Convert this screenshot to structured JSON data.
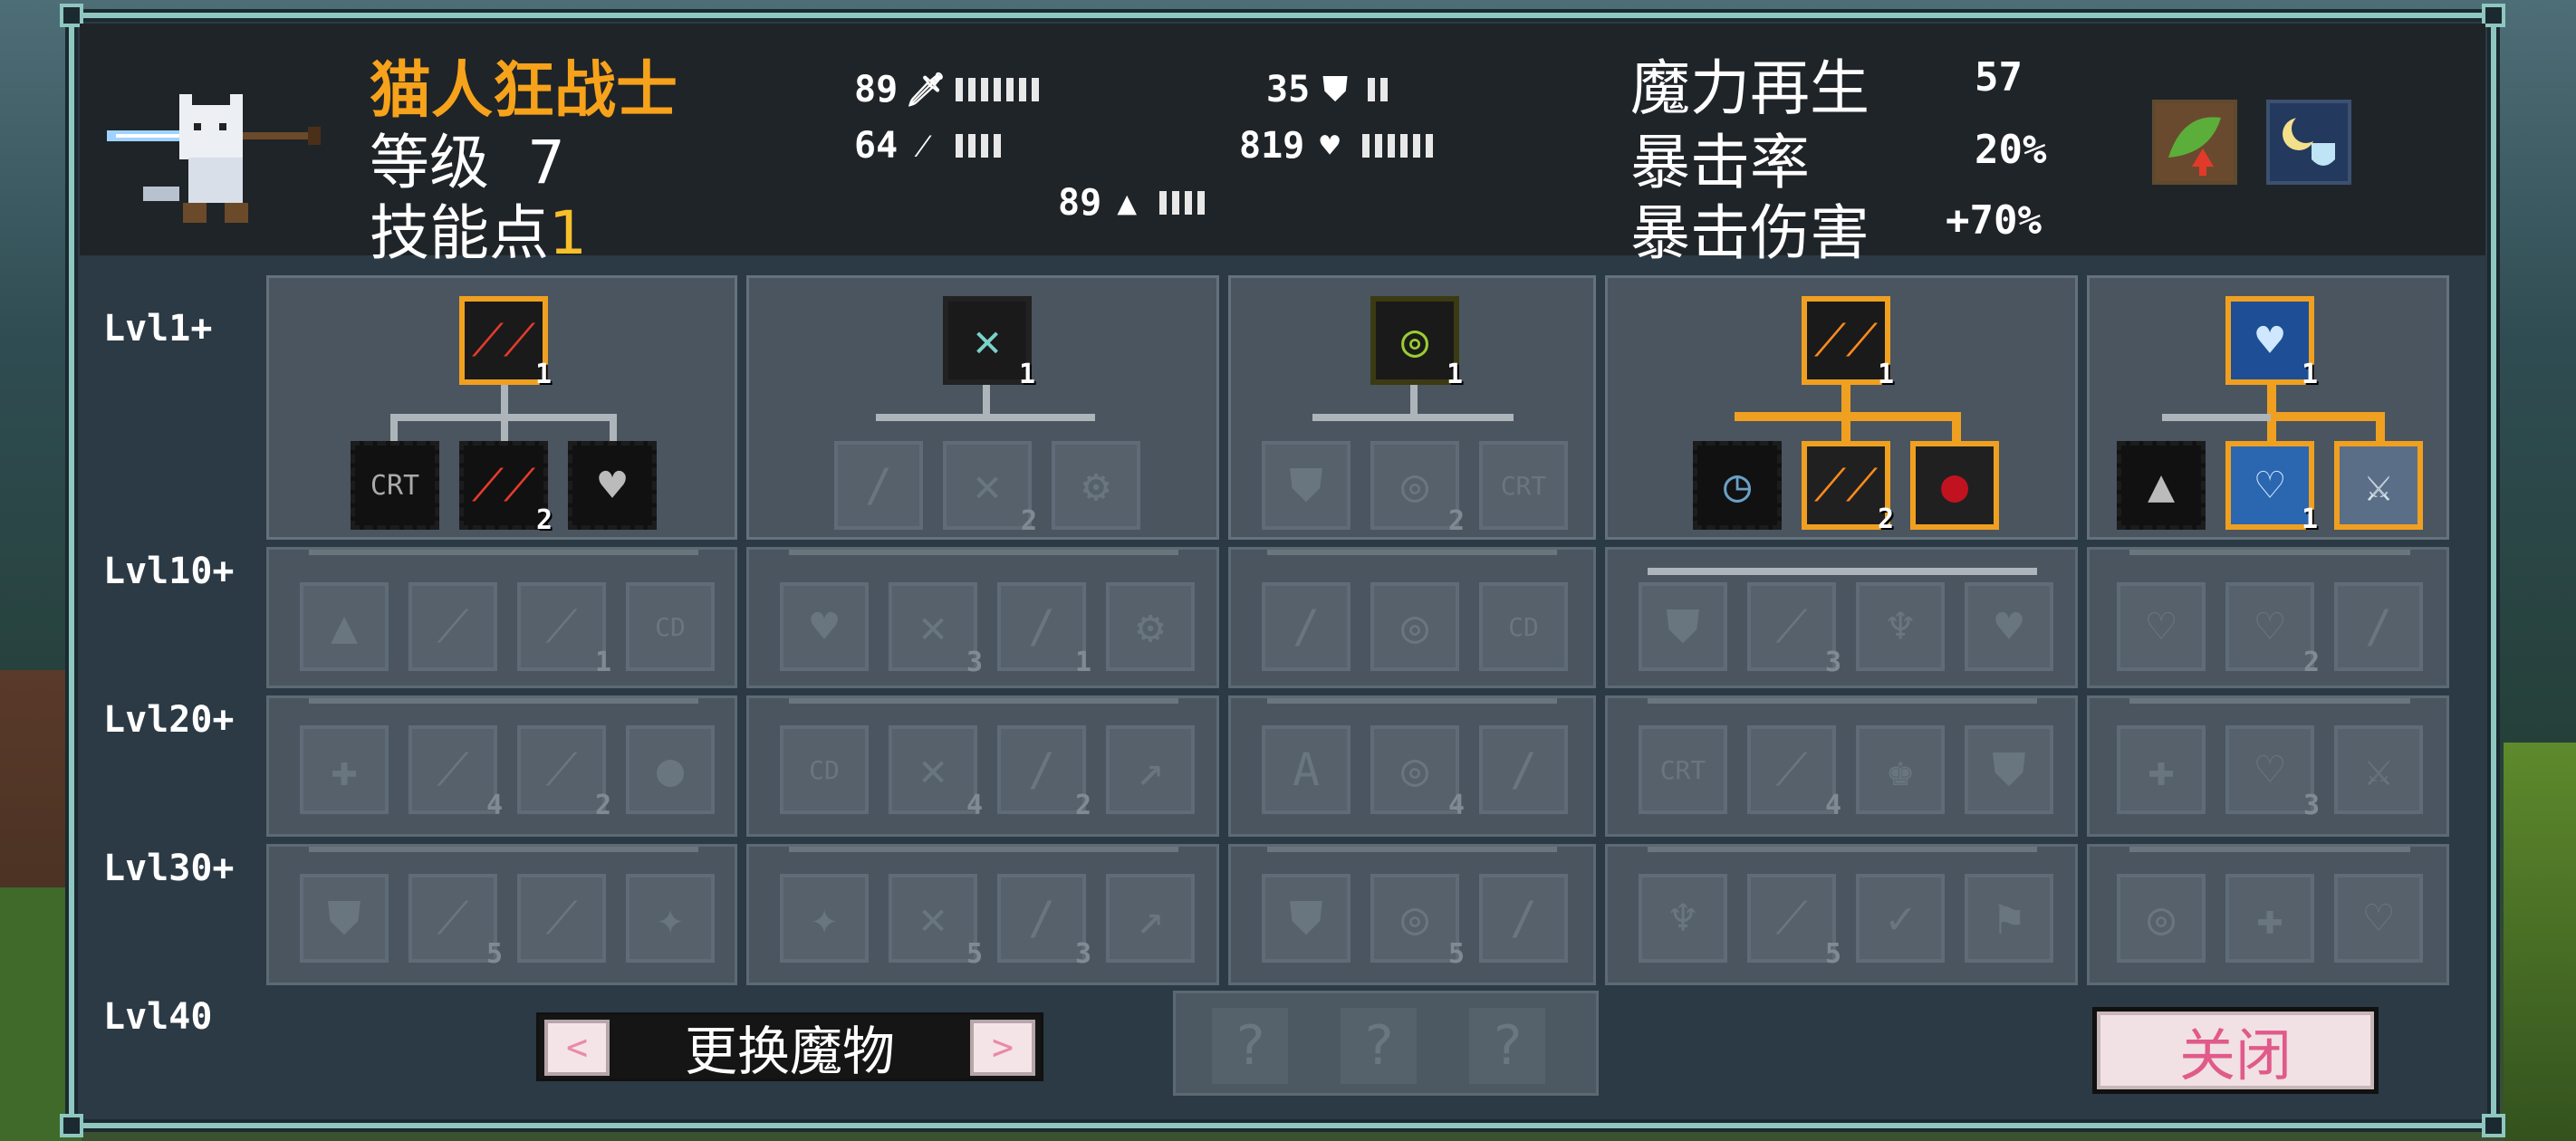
{
  "character": {
    "name": "猫人狂战士",
    "level_label": "等级",
    "level_value": "7",
    "skill_points_label": "技能点",
    "skill_points_value": "1"
  },
  "stats": {
    "attack": "89",
    "magic": "64",
    "defense": "35",
    "hp": "819",
    "speed": "89"
  },
  "attributes": [
    {
      "label": "魔力再生",
      "value": "57"
    },
    {
      "label": "暴击率",
      "value": "20%"
    },
    {
      "label": "暴击伤害",
      "value": "+70%"
    }
  ],
  "level_tiers": [
    "Lvl1+",
    "Lvl10+",
    "Lvl20+",
    "Lvl30+",
    "Lvl40"
  ],
  "trees": [
    {
      "top_icon": "claw-slash-icon",
      "top_badge": "1",
      "children": [
        {
          "icon": "crit-icon",
          "label": "CRT"
        },
        {
          "icon": "claw-slash-icon",
          "badge": "2"
        },
        {
          "icon": "heart-bars-icon"
        }
      ],
      "tier10": [
        "1"
      ],
      "tier20": [
        "4",
        "2"
      ],
      "tier30": [
        "5"
      ]
    },
    {
      "top_icon": "cross-blades-icon",
      "top_badge": "1",
      "children": [
        {
          "icon": "sword-bars-icon"
        },
        {
          "icon": "cross-blades-icon",
          "badge": "2"
        },
        {
          "icon": "gear-icon"
        }
      ],
      "tier10": [
        "3",
        "1"
      ],
      "tier20": [
        "4",
        "2"
      ],
      "tier30": [
        "5",
        "3"
      ]
    },
    {
      "top_icon": "orbit-ring-icon",
      "top_badge": "1",
      "children": [
        {
          "icon": "shield-bars-icon"
        },
        {
          "icon": "orbit-ring-icon",
          "badge": "2"
        },
        {
          "icon": "crit-icon",
          "label": "CRT"
        }
      ],
      "tier10": [],
      "tier20": [
        "4"
      ],
      "tier30": [
        "5"
      ]
    },
    {
      "top_icon": "flame-slash-icon",
      "top_badge": "1",
      "children": [
        {
          "icon": "clock-icon"
        },
        {
          "icon": "flame-slash-icon",
          "badge": "2"
        },
        {
          "icon": "blood-drop-icon"
        }
      ],
      "tier10": [
        "3"
      ],
      "tier20": [
        "4"
      ],
      "tier30": [
        "5"
      ]
    },
    {
      "top_icon": "heart-icon",
      "top_badge": "1",
      "children": [
        {
          "icon": "weight-bars-icon"
        },
        {
          "icon": "heart-swap-icon",
          "badge": "1"
        },
        {
          "icon": "ghost-sword-icon"
        }
      ],
      "tier10": [
        "2"
      ],
      "tier20": [
        "3"
      ],
      "tier30": []
    }
  ],
  "buttons": {
    "swap_label": "更换魔物",
    "prev_arrow": "<",
    "next_arrow": ">",
    "close_label": "关闭"
  },
  "locked_slots": [
    "?",
    "?",
    "?"
  ],
  "colors": {
    "accent": "#f0a020",
    "name": "#f7a21b",
    "panel": "#2b3a44",
    "border": "#8fc7c0"
  }
}
